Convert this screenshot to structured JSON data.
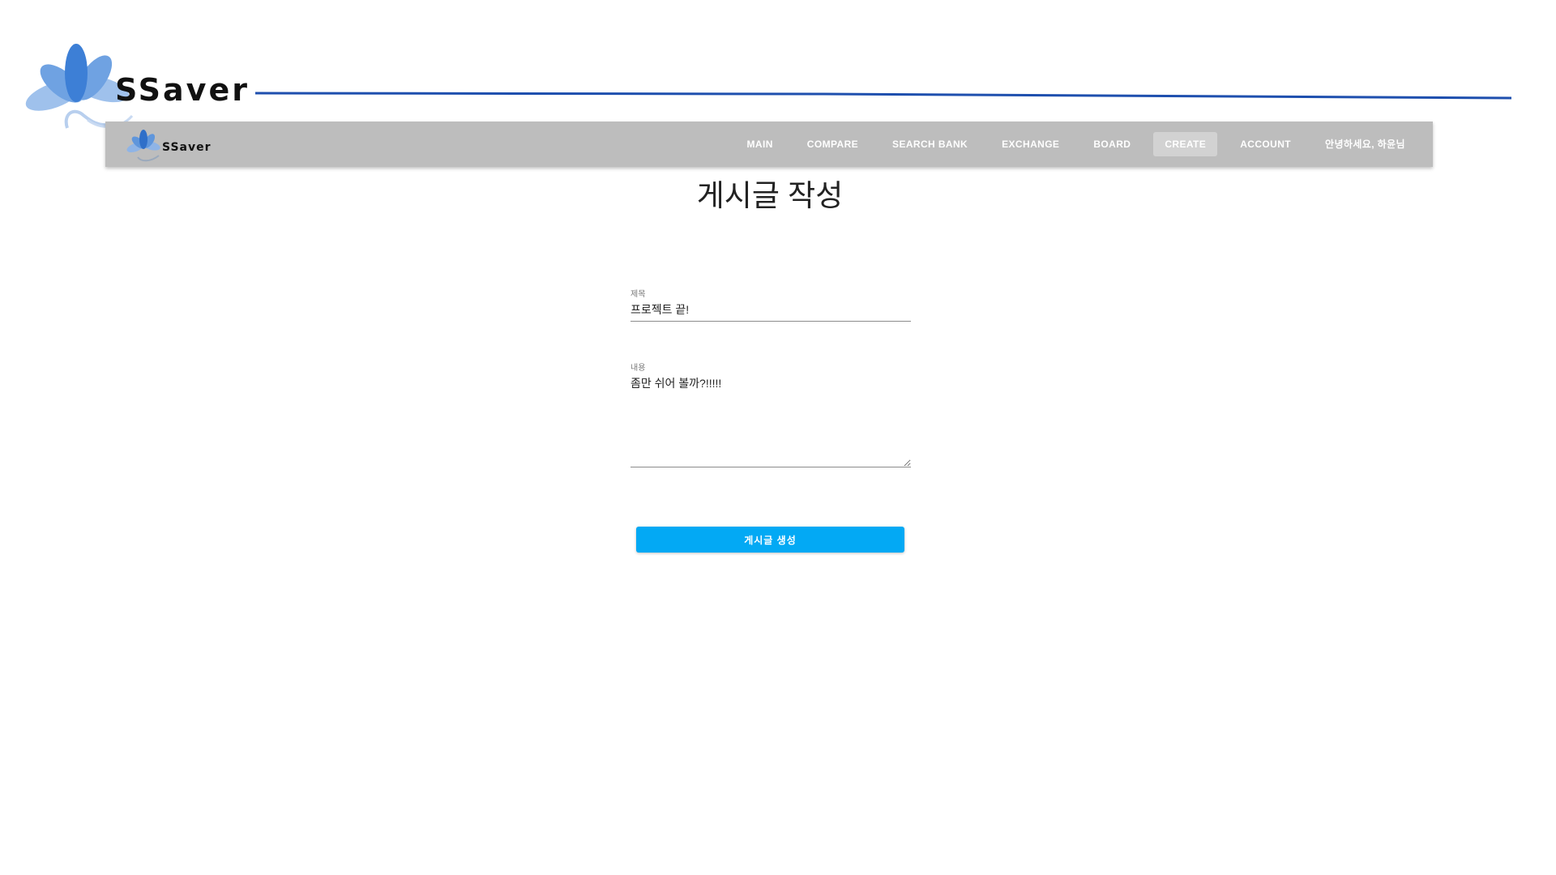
{
  "brand": {
    "name": "SSaver",
    "accent_color": "#1e4fae",
    "logo_icon": "lotus-icon"
  },
  "navbar": {
    "brand": "SSaver",
    "background": "#bdbdbd",
    "items": [
      {
        "label": "MAIN"
      },
      {
        "label": "COMPARE"
      },
      {
        "label": "SEARCH BANK"
      },
      {
        "label": "EXCHANGE"
      },
      {
        "label": "BOARD"
      },
      {
        "label": "CREATE",
        "active": true
      },
      {
        "label": "ACCOUNT"
      },
      {
        "label": "안녕하세요, 하윤님"
      }
    ]
  },
  "page": {
    "title": "게시글 작성"
  },
  "form": {
    "title_label": "제목",
    "title_value": "프로젝트 끝!",
    "content_label": "내용",
    "content_value": "좀만 쉬어 볼까?!!!!!",
    "submit_label": "게시글 생성",
    "submit_color": "#03a9f4"
  }
}
